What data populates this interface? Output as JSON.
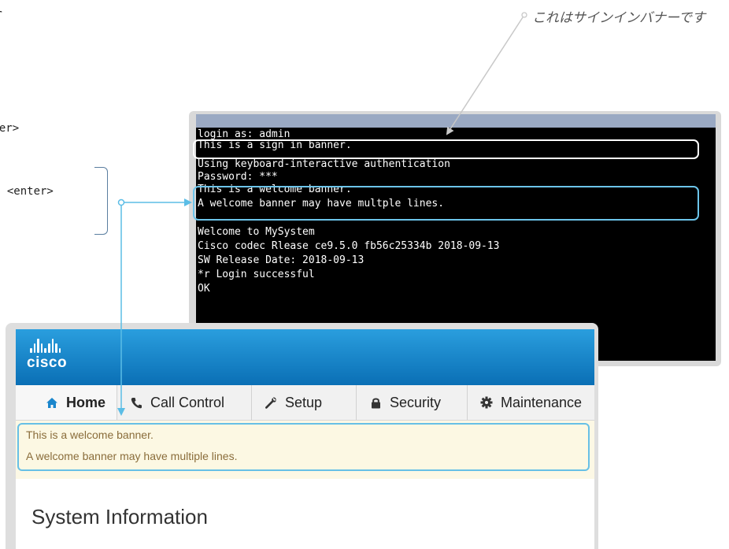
{
  "left_fragments": [
    "ar",
    "nter>",
    ", <enter>"
  ],
  "annotation": {
    "text": "これはサインインバナーです"
  },
  "terminal": {
    "lines": [
      "login as: admin",
      "This is a sign in banner.",
      "Using keyboard-interactive authentication",
      "Password: ***",
      "This is a welcome banner.",
      "A welcome banner may have multple lines.",
      "",
      "Welcome to MySystem",
      "Cisco codec Rlease ce9.5.0 fb56c25334b 2018-09-13",
      "SW Release Date: 2018-09-13",
      "*r Login successful",
      "OK"
    ]
  },
  "web": {
    "logo_text": "cisco",
    "nav": [
      {
        "label": "Home",
        "icon": "home-icon"
      },
      {
        "label": "Call Control",
        "icon": "phone-icon"
      },
      {
        "label": "Setup",
        "icon": "wrench-icon"
      },
      {
        "label": "Security",
        "icon": "lock-icon"
      },
      {
        "label": "Maintenance",
        "icon": "gear-icon"
      }
    ],
    "banner_lines": [
      "This is a welcome banner.",
      "A welcome banner may have multiple lines."
    ],
    "page_title": "System Information"
  },
  "colors": {
    "accent_blue": "#5bbde6",
    "header_blue": "#1a86cc",
    "banner_text": "#8a6d3b",
    "banner_bg": "#fcf8e3"
  }
}
